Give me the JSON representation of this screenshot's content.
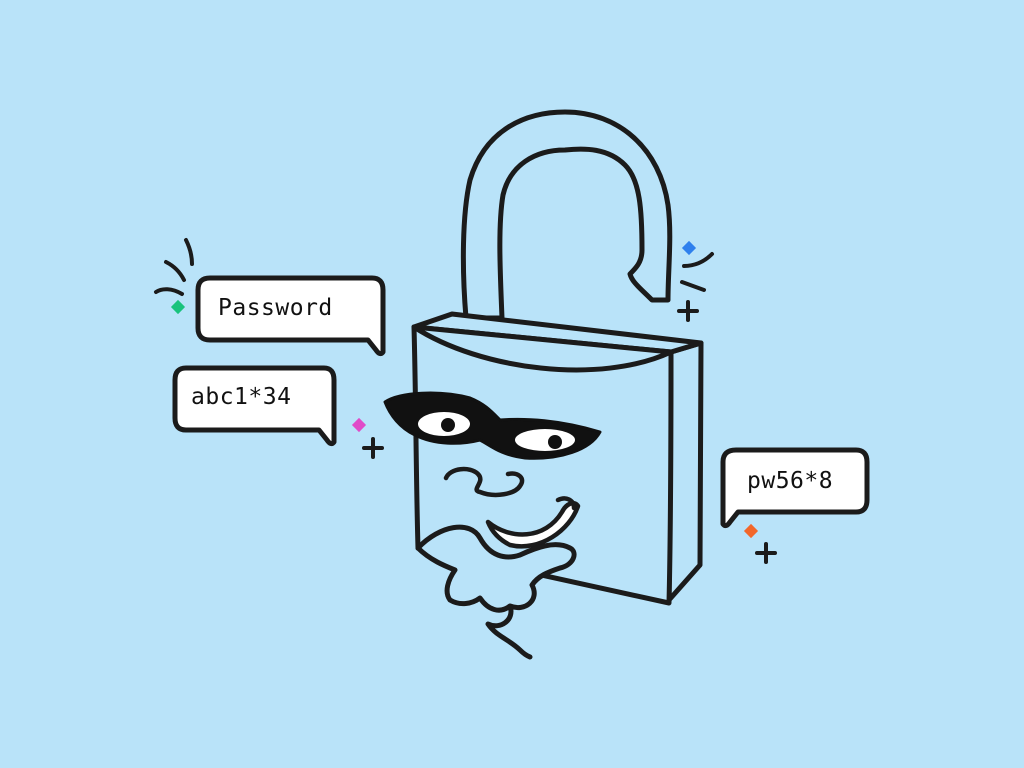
{
  "bubbles": {
    "password": "Password",
    "abc": "abc1*34",
    "pw": "pw56*8"
  },
  "colors": {
    "background": "#b9e3f9",
    "stroke": "#1b1b1b",
    "fill": "#ffffff",
    "sparkle_green": "#19c37d",
    "sparkle_pink": "#e04bc8",
    "sparkle_blue": "#2f80ed",
    "sparkle_orange": "#f2672a"
  },
  "icons": [
    "padlock-character",
    "speech-bubble",
    "sparkle-icon",
    "plus-icon"
  ]
}
